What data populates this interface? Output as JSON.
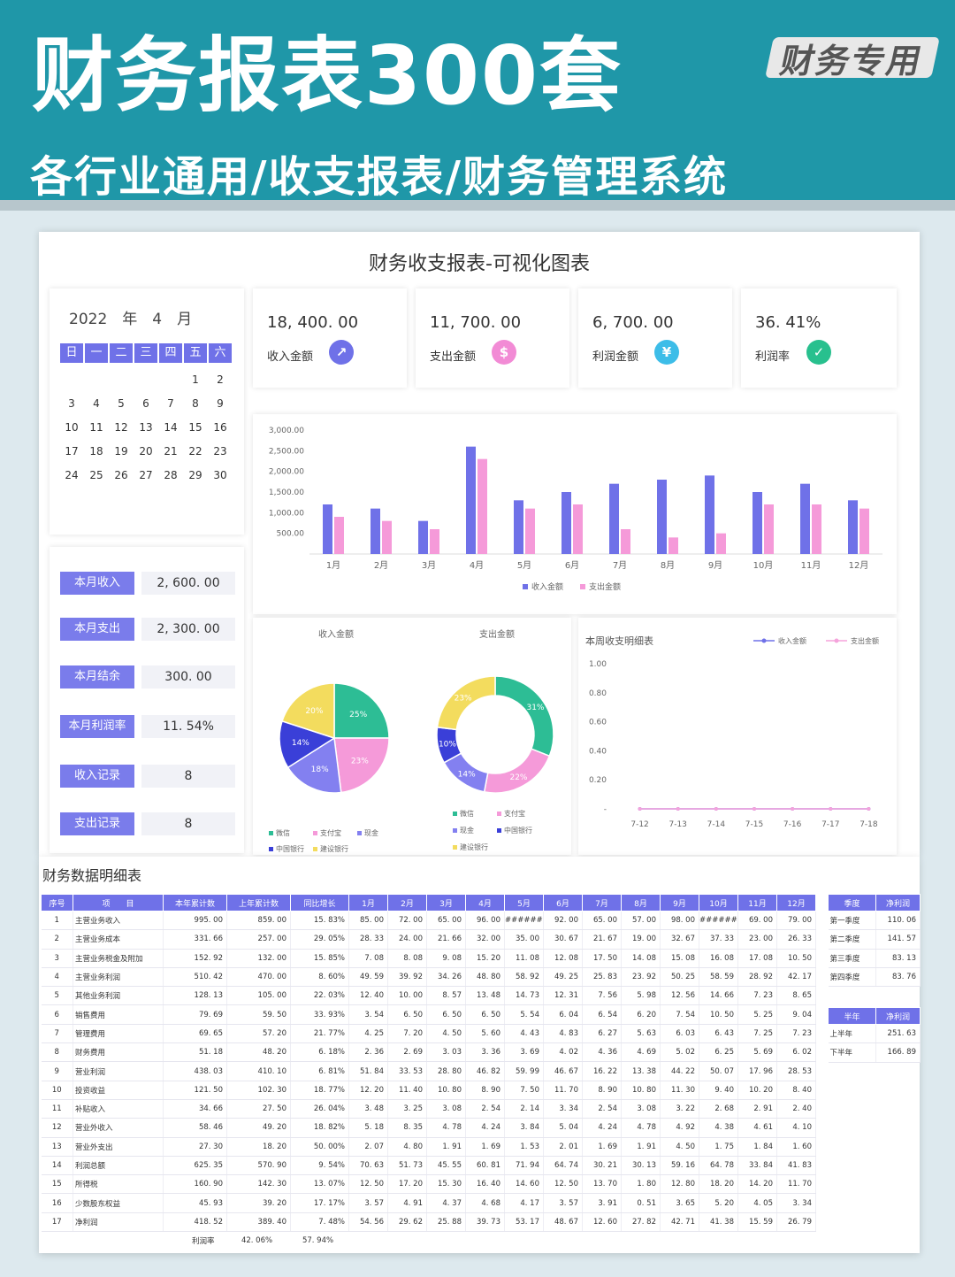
{
  "banner": {
    "title": "财务报表300套",
    "badge": "财务专用",
    "subtitle": "各行业通用/收支报表/财务管理系统"
  },
  "dashboard": {
    "title": "财务收支报表-可视化图表",
    "calendar": {
      "year_month": "2022　年　4　月",
      "weekdays": [
        "日",
        "一",
        "二",
        "三",
        "四",
        "五",
        "六"
      ],
      "weeks": [
        [
          "",
          "",
          "",
          "",
          "",
          "1",
          "2"
        ],
        [
          "3",
          "4",
          "5",
          "6",
          "7",
          "8",
          "9"
        ],
        [
          "10",
          "11",
          "12",
          "13",
          "14",
          "15",
          "16"
        ],
        [
          "17",
          "18",
          "19",
          "20",
          "21",
          "22",
          "23"
        ],
        [
          "24",
          "25",
          "26",
          "27",
          "28",
          "29",
          "30"
        ]
      ]
    },
    "kpis": [
      {
        "value": "18, 400. 00",
        "label": "收入金额",
        "icon": "trend-up-icon",
        "color": "#6f71e8",
        "glyph": "↗"
      },
      {
        "value": "11, 700. 00",
        "label": "支出金额",
        "icon": "dollar-icon",
        "color": "#f28bd5",
        "glyph": "$"
      },
      {
        "value": "6, 700. 00",
        "label": "利润金额",
        "icon": "yen-icon",
        "color": "#3dbde8",
        "glyph": "¥"
      },
      {
        "value": "36. 41%",
        "label": "利润率",
        "icon": "check-icon",
        "color": "#28c08e",
        "glyph": "✓"
      }
    ],
    "summary": [
      {
        "label": "本月收入",
        "value": "2, 600. 00"
      },
      {
        "label": "本月支出",
        "value": "2, 300. 00"
      },
      {
        "label": "本月结余",
        "value": "300. 00"
      },
      {
        "label": "本月利润率",
        "value": "11. 54%"
      },
      {
        "label": "收入记录",
        "value": "8"
      },
      {
        "label": "支出记录",
        "value": "8"
      }
    ],
    "line_title": "本周收支明细表"
  },
  "colors": {
    "income": "#6f71e8",
    "expense": "#f59ad9",
    "line_income": "#6f71e8",
    "line_expense": "#f5a3db"
  },
  "chart_data": [
    {
      "type": "bar",
      "categories": [
        "1月",
        "2月",
        "3月",
        "4月",
        "5月",
        "6月",
        "7月",
        "8月",
        "9月",
        "10月",
        "11月",
        "12月"
      ],
      "series": [
        {
          "name": "收入金额",
          "values": [
            1200,
            1100,
            800,
            2600,
            1300,
            1500,
            1700,
            1800,
            1900,
            1500,
            1700,
            1300
          ]
        },
        {
          "name": "支出金额",
          "values": [
            900,
            800,
            600,
            2300,
            1100,
            1200,
            600,
            400,
            500,
            1200,
            1200,
            1100
          ]
        }
      ],
      "y_ticks": [
        "",
        "500.00",
        "1,000.00",
        "1,500.00",
        "2,000.00",
        "2,500.00",
        "3,000.00"
      ],
      "ylim": [
        0,
        3000
      ]
    },
    {
      "type": "pie",
      "title": "收入金额",
      "labels": [
        "微信",
        "支付宝",
        "现金",
        "中国银行",
        "建设银行"
      ],
      "values": [
        25,
        23,
        18,
        14,
        20
      ],
      "value_labels": [
        "25%",
        "23%",
        "18%",
        "14%",
        "20%"
      ],
      "colors": [
        "#2dbd95",
        "#f59ad9",
        "#8380f0",
        "#3a3fd8",
        "#f3dc5e"
      ]
    },
    {
      "type": "pie",
      "title": "支出金额",
      "donut": true,
      "labels": [
        "微信",
        "支付宝",
        "现金",
        "中国银行",
        "建设银行"
      ],
      "values": [
        31,
        22,
        14,
        10,
        23
      ],
      "value_labels": [
        "31%",
        "22%",
        "14%",
        "10%",
        "23%"
      ],
      "colors": [
        "#2dbd95",
        "#f59ad9",
        "#8380f0",
        "#3a3fd8",
        "#f3dc5e"
      ]
    },
    {
      "type": "line",
      "title": "本周收支明细表",
      "x": [
        "7-12",
        "7-13",
        "7-14",
        "7-15",
        "7-16",
        "7-17",
        "7-18"
      ],
      "series": [
        {
          "name": "收入金额",
          "values": [
            0,
            0,
            0,
            0,
            0,
            0,
            0
          ]
        },
        {
          "name": "支出金额",
          "values": [
            0,
            0,
            0,
            0,
            0,
            0,
            0
          ]
        }
      ],
      "y_ticks": [
        "-",
        "0.20",
        "0.40",
        "0.60",
        "0.80",
        "1.00"
      ],
      "ylim": [
        0,
        1
      ]
    }
  ],
  "detail": {
    "title": "财务数据明细表",
    "headers": [
      "序号",
      "项　　目",
      "本年累计数",
      "上年累计数",
      "同比增长",
      "1月",
      "2月",
      "3月",
      "4月",
      "5月",
      "6月",
      "7月",
      "8月",
      "9月",
      "10月",
      "11月",
      "12月"
    ],
    "rows": [
      [
        "1",
        "主营业务收入",
        "995. 00",
        "859. 00",
        "15. 83%",
        "85. 00",
        "72. 00",
        "65. 00",
        "96. 00",
        "######",
        "92. 00",
        "65. 00",
        "57. 00",
        "98. 00",
        "######",
        "69. 00",
        "79. 00"
      ],
      [
        "2",
        "主营业务成本",
        "331. 66",
        "257. 00",
        "29. 05%",
        "28. 33",
        "24. 00",
        "21. 66",
        "32. 00",
        "35. 00",
        "30. 67",
        "21. 67",
        "19. 00",
        "32. 67",
        "37. 33",
        "23. 00",
        "26. 33"
      ],
      [
        "3",
        "主营业务税金及附加",
        "152. 92",
        "132. 00",
        "15. 85%",
        "7. 08",
        "8. 08",
        "9. 08",
        "15. 20",
        "11. 08",
        "12. 08",
        "17. 50",
        "14. 08",
        "15. 08",
        "16. 08",
        "17. 08",
        "10. 50"
      ],
      [
        "4",
        "主营业务利润",
        "510. 42",
        "470. 00",
        "8. 60%",
        "49. 59",
        "39. 92",
        "34. 26",
        "48. 80",
        "58. 92",
        "49. 25",
        "25. 83",
        "23. 92",
        "50. 25",
        "58. 59",
        "28. 92",
        "42. 17"
      ],
      [
        "5",
        "其他业务利润",
        "128. 13",
        "105. 00",
        "22. 03%",
        "12. 40",
        "10. 00",
        "8. 57",
        "13. 48",
        "14. 73",
        "12. 31",
        "7. 56",
        "5. 98",
        "12. 56",
        "14. 66",
        "7. 23",
        "8. 65"
      ],
      [
        "6",
        "销售费用",
        "79. 69",
        "59. 50",
        "33. 93%",
        "3. 54",
        "6. 50",
        "6. 50",
        "6. 50",
        "5. 54",
        "6. 04",
        "6. 54",
        "6. 20",
        "7. 54",
        "10. 50",
        "5. 25",
        "9. 04"
      ],
      [
        "7",
        "管理费用",
        "69. 65",
        "57. 20",
        "21. 77%",
        "4. 25",
        "7. 20",
        "4. 50",
        "5. 60",
        "4. 43",
        "4. 83",
        "6. 27",
        "5. 63",
        "6. 03",
        "6. 43",
        "7. 25",
        "7. 23"
      ],
      [
        "8",
        "财务费用",
        "51. 18",
        "48. 20",
        "6. 18%",
        "2. 36",
        "2. 69",
        "3. 03",
        "3. 36",
        "3. 69",
        "4. 02",
        "4. 36",
        "4. 69",
        "5. 02",
        "6. 25",
        "5. 69",
        "6. 02"
      ],
      [
        "9",
        "营业利润",
        "438. 03",
        "410. 10",
        "6. 81%",
        "51. 84",
        "33. 53",
        "28. 80",
        "46. 82",
        "59. 99",
        "46. 67",
        "16. 22",
        "13. 38",
        "44. 22",
        "50. 07",
        "17. 96",
        "28. 53"
      ],
      [
        "10",
        "投资收益",
        "121. 50",
        "102. 30",
        "18. 77%",
        "12. 20",
        "11. 40",
        "10. 80",
        "8. 90",
        "7. 50",
        "11. 70",
        "8. 90",
        "10. 80",
        "11. 30",
        "9. 40",
        "10. 20",
        "8. 40"
      ],
      [
        "11",
        "补贴收入",
        "34. 66",
        "27. 50",
        "26. 04%",
        "3. 48",
        "3. 25",
        "3. 08",
        "2. 54",
        "2. 14",
        "3. 34",
        "2. 54",
        "3. 08",
        "3. 22",
        "2. 68",
        "2. 91",
        "2. 40"
      ],
      [
        "12",
        "营业外收入",
        "58. 46",
        "49. 20",
        "18. 82%",
        "5. 18",
        "8. 35",
        "4. 78",
        "4. 24",
        "3. 84",
        "5. 04",
        "4. 24",
        "4. 78",
        "4. 92",
        "4. 38",
        "4. 61",
        "4. 10"
      ],
      [
        "13",
        "营业外支出",
        "27. 30",
        "18. 20",
        "50. 00%",
        "2. 07",
        "4. 80",
        "1. 91",
        "1. 69",
        "1. 53",
        "2. 01",
        "1. 69",
        "1. 91",
        "4. 50",
        "1. 75",
        "1. 84",
        "1. 60"
      ],
      [
        "14",
        "利润总额",
        "625. 35",
        "570. 90",
        "9. 54%",
        "70. 63",
        "51. 73",
        "45. 55",
        "60. 81",
        "71. 94",
        "64. 74",
        "30. 21",
        "30. 13",
        "59. 16",
        "64. 78",
        "33. 84",
        "41. 83"
      ],
      [
        "15",
        "所得税",
        "160. 90",
        "142. 30",
        "13. 07%",
        "12. 50",
        "17. 20",
        "15. 30",
        "16. 40",
        "14. 60",
        "12. 50",
        "13. 70",
        "1. 80",
        "12. 80",
        "18. 20",
        "14. 20",
        "11. 70"
      ],
      [
        "16",
        "少数股东权益",
        "45. 93",
        "39. 20",
        "17. 17%",
        "3. 57",
        "4. 91",
        "4. 37",
        "4. 68",
        "4. 17",
        "3. 57",
        "3. 91",
        "0. 51",
        "3. 65",
        "5. 20",
        "4. 05",
        "3. 34"
      ],
      [
        "17",
        "净利润",
        "418. 52",
        "389. 40",
        "7. 48%",
        "54. 56",
        "29. 62",
        "25. 88",
        "39. 73",
        "53. 17",
        "48. 67",
        "12. 60",
        "27. 82",
        "42. 71",
        "41. 38",
        "15. 59",
        "26. 79"
      ]
    ],
    "footer": [
      "利润率",
      "42. 06%",
      "57. 94%"
    ],
    "quarter": {
      "headers": [
        "季度",
        "净利润"
      ],
      "rows": [
        [
          "第一季度",
          "110. 06"
        ],
        [
          "第二季度",
          "141. 57"
        ],
        [
          "第三季度",
          "83. 13"
        ],
        [
          "第四季度",
          "83. 76"
        ]
      ]
    },
    "half": {
      "headers": [
        "半年",
        "净利润"
      ],
      "rows": [
        [
          "上半年",
          "251. 63"
        ],
        [
          "下半年",
          "166. 89"
        ]
      ]
    }
  }
}
